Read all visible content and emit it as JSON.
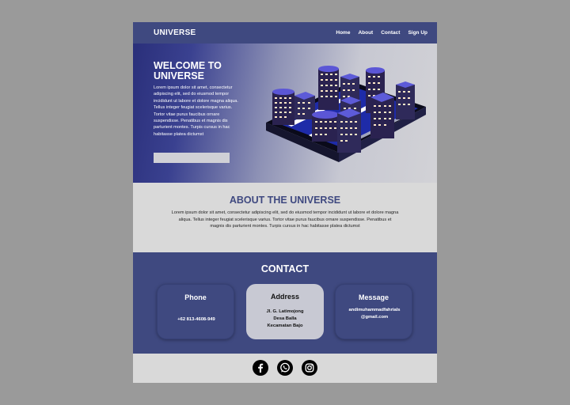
{
  "nav": {
    "brand": "UNIVERSE",
    "links": [
      "Home",
      "About",
      "Contact",
      "Sign Up"
    ]
  },
  "hero": {
    "title": "WELCOME TO UNIVERSE",
    "text": "Lorem ipsum dolor sit amet, consectetur adipiscing elit, sed do eiusmod tempor incididunt ut labore et dolore magna aliqua. Tellus integer feugiat scelerisque varius. Tortor vitae purus faucibus ornare suspendisse. Penatibus et magnis dis parturient montes. Turpis cursus in hac habitasse platea dictumst"
  },
  "about": {
    "title": "ABOUT THE UNIVERSE",
    "text": "Lorem ipsum dolor sit amet, consectetur adipiscing elit, sed do eiusmod tempor incididunt ut labore et dolore magna aliqua. Tellus integer feugiat scelerisque varius. Tortor vitae purus faucibus ornare suspendisse. Penatibus et magnis dis parturient montes. Turpis cursus in hac habitasse platea dictumst"
  },
  "contact": {
    "title": "CONTACT",
    "cards": [
      {
        "title": "Phone",
        "value": "+62 813-4608-949"
      },
      {
        "title": "Address",
        "value": "Jl. G. Latimojong\nDesa Balla\nKecamatan Bajo"
      },
      {
        "title": "Message",
        "value": "andimuhammadfahrials\n@gmail.com"
      }
    ]
  },
  "footer": {
    "icons": [
      "facebook-icon",
      "whatsapp-icon",
      "instagram-icon"
    ]
  },
  "colors": {
    "primary": "#3f4980",
    "page_background": "#9a9a9a",
    "light_section": "#d9d9d9"
  }
}
